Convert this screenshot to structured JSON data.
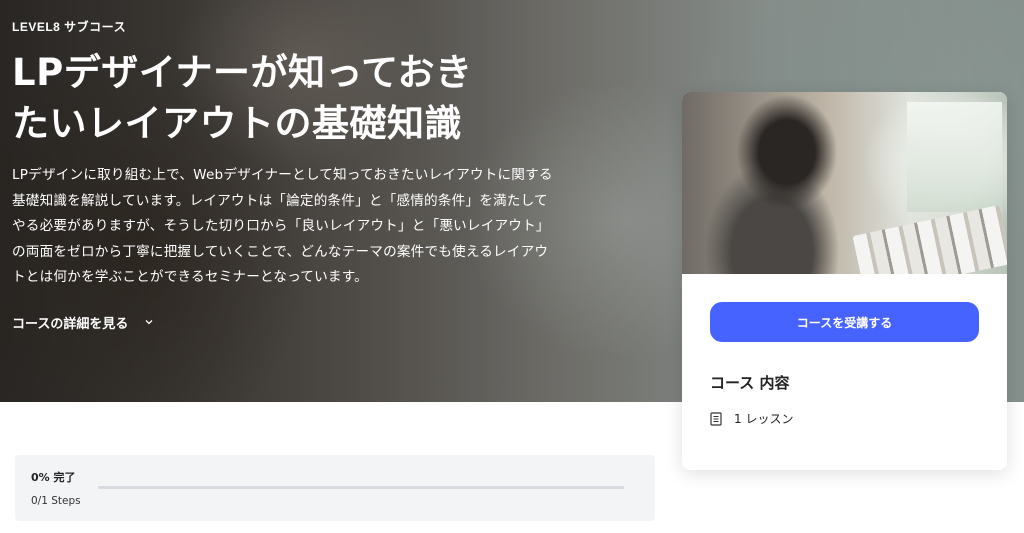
{
  "hero": {
    "eyebrow": "LEVEL8 サブコース",
    "title_line1": "LPデザイナーが知っておき",
    "title_line2": "たいレイアウトの基礎知識",
    "description": "LPデザインに取り組む上で、Webデザイナーとして知っておきたいレイアウトに関する基礎知識を解説しています。レイアウトは「論定的条件」と「感情的条件」を満たしてやる必要がありますが、そうした切り口から「良いレイアウト」と「悪いレイアウト」の両面をゼロから丁寧に把握していくことで、どんなテーマの案件でも使えるレイアウトとは何かを学ぶことができるセミナーとなっています。",
    "detail_link": "コースの詳細を見る",
    "detail_icon": "chevron-down-icon"
  },
  "progress": {
    "percent_label": "0% 完了",
    "steps_label": "0/1 Steps",
    "percent": 0
  },
  "card": {
    "enroll_button": "コースを受講する",
    "content_title": "コース 内容",
    "lesson_count": "1 レッスン",
    "lesson_icon": "document-icon"
  },
  "colors": {
    "accent": "#4663ff",
    "progress_track": "#d7dadf",
    "panel_bg": "#f3f4f6"
  }
}
